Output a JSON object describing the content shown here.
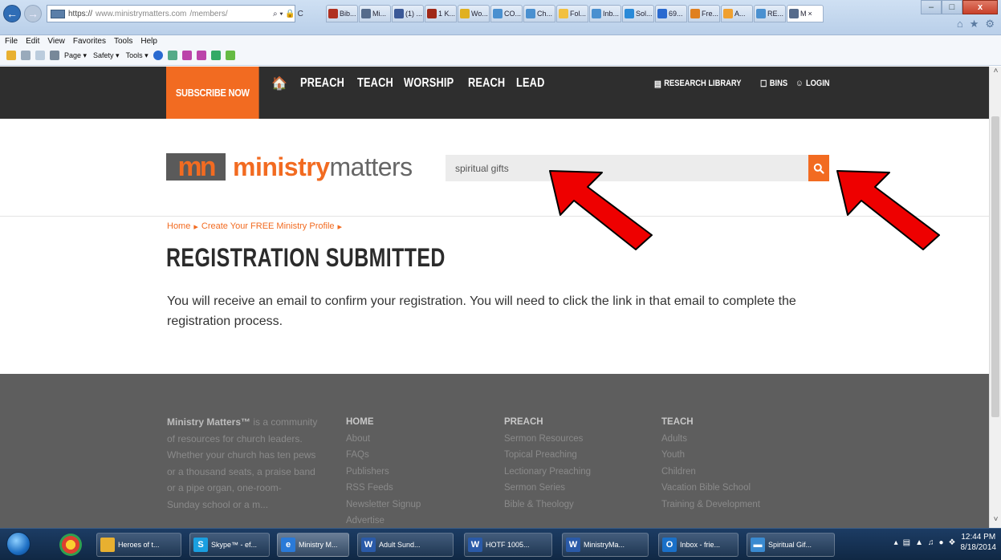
{
  "browser": {
    "url_scheme": "https://",
    "url_host": "www.ministrymatters.com",
    "url_path": "/members/",
    "addr_tools": "⌕ ▾ 🔒 C",
    "tabs": [
      {
        "label": "Bib...",
        "color": "#b03020"
      },
      {
        "label": "Mi...",
        "color": "#556b8b"
      },
      {
        "label": "(1) ...",
        "color": "#3b5998"
      },
      {
        "label": "1 K...",
        "color": "#a02818"
      },
      {
        "label": "Wo...",
        "color": "#e0b020"
      },
      {
        "label": "CO...",
        "color": "#4a90d0"
      },
      {
        "label": "Ch...",
        "color": "#4a90d0"
      },
      {
        "label": "Fol...",
        "color": "#f2c040"
      },
      {
        "label": "Inb...",
        "color": "#4a90d0"
      },
      {
        "label": "Sol...",
        "color": "#2a8ad8"
      },
      {
        "label": "69...",
        "color": "#2a6ad0"
      },
      {
        "label": "Fre...",
        "color": "#e08020"
      },
      {
        "label": "A...",
        "color": "#f0a030"
      },
      {
        "label": "RE...",
        "color": "#4a90d0"
      }
    ],
    "active_tab": "M",
    "active_tab_close": "×",
    "win_min": "–",
    "win_max": "□",
    "win_close": "x",
    "menus": [
      "File",
      "Edit",
      "View",
      "Favorites",
      "Tools",
      "Help"
    ],
    "commands": [
      "Page ▾",
      "Safety ▾",
      "Tools ▾"
    ]
  },
  "site": {
    "subscribe_label": "SUBSCRIBE NOW",
    "home_icon": "🏠",
    "nav": [
      "PREACH",
      "TEACH",
      "WORSHIP",
      "REACH",
      "LEAD"
    ],
    "util_nav": [
      {
        "icon": "▤",
        "label": "RESEARCH LIBRARY"
      },
      {
        "icon": "☐",
        "label": "BINS"
      },
      {
        "icon": "☺",
        "label": "LOGIN"
      }
    ],
    "logo_mark": "mn",
    "logo_bold": "ministry",
    "logo_thin": "matters",
    "search_value": "spiritual gifts",
    "accent_color": "#f26b21"
  },
  "content": {
    "breadcrumb": [
      "Home",
      "Create Your FREE Ministry Profile"
    ],
    "breadcrumb_sep": "▸",
    "title": "REGISTRATION SUBMITTED",
    "body": "You will receive an email to confirm your registration. You will need to click the link in that email to complete the registration process."
  },
  "footer": {
    "about_brand": "Ministry Matters™",
    "about_text": " is a community of resources for church leaders. Whether your church has ten pews or a thousand seats, a praise band or a pipe organ, one-room-",
    "about_cutoff": "Sunday school or a m...",
    "columns": [
      {
        "head": "HOME",
        "items": [
          "About",
          "FAQs",
          "Publishers",
          "RSS Feeds",
          "Newsletter Signup",
          "Advertise"
        ]
      },
      {
        "head": "PREACH",
        "items": [
          "Sermon Resources",
          "Topical Preaching",
          "Lectionary Preaching",
          "Sermon Series",
          "Bible & Theology"
        ]
      },
      {
        "head": "TEACH",
        "items": [
          "Adults",
          "Youth",
          "Children",
          "Vacation Bible School",
          "Training & Development"
        ]
      }
    ]
  },
  "taskbar": {
    "items": [
      {
        "label": "Heroes of t...",
        "icon": "folder",
        "color": "#e8b030"
      },
      {
        "label": "Skype™ - ef...",
        "icon": "S",
        "color": "#1a9fe0"
      },
      {
        "label": "Ministry M...",
        "icon": "e",
        "color": "#2a7ad8"
      },
      {
        "label": "Adult Sund...",
        "icon": "W",
        "color": "#2a5aa8"
      },
      {
        "label": "HOTF 1005...",
        "icon": "W",
        "color": "#2a5aa8"
      },
      {
        "label": "MinistryMa...",
        "icon": "W",
        "color": "#2a5aa8"
      },
      {
        "label": "Inbox - frie...",
        "icon": "O",
        "color": "#1a70c8"
      },
      {
        "label": "Spiritual Gif...",
        "icon": "▬",
        "color": "#3a8ad0"
      }
    ],
    "time": "12:44 PM",
    "date": "8/18/2014"
  }
}
